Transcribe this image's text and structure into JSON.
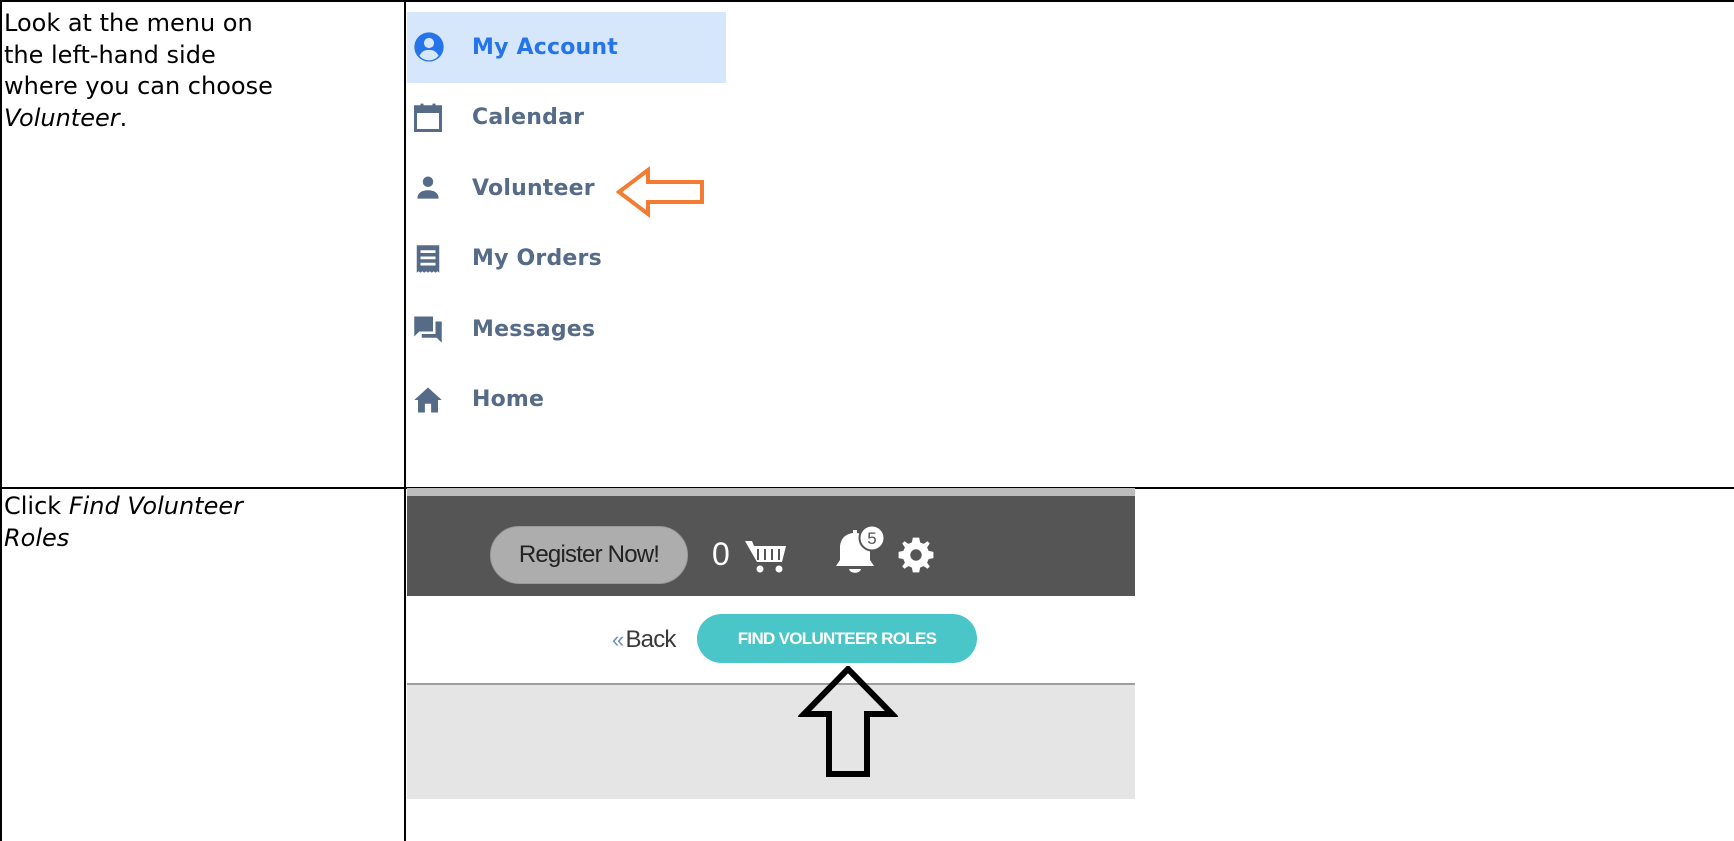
{
  "row1": {
    "instruction_lines": [
      "Look at the menu on",
      "the left-hand side",
      "where you can choose"
    ],
    "instruction_emph": "Volunteer",
    "instruction_tail": "."
  },
  "menu": {
    "items": [
      {
        "label": "My Account",
        "icon": "account-circle-icon",
        "active": true
      },
      {
        "label": "Calendar",
        "icon": "calendar-icon",
        "active": false
      },
      {
        "label": "Volunteer",
        "icon": "person-icon",
        "active": false
      },
      {
        "label": "My Orders",
        "icon": "receipt-icon",
        "active": false
      },
      {
        "label": "Messages",
        "icon": "chat-bubbles-icon",
        "active": false
      },
      {
        "label": "Home",
        "icon": "home-icon",
        "active": false
      }
    ],
    "active_color": "#2574ea",
    "active_bg": "#d6e6fb",
    "item_color": "#556b87"
  },
  "row2": {
    "instruction_prefix": "Click ",
    "instruction_emph_line1": "Find Volunteer",
    "instruction_emph_line2": "Roles"
  },
  "shot": {
    "register_label": "Register Now!",
    "cart_count": "0",
    "notification_count": "5",
    "back_chevron": "«",
    "back_label": "Back",
    "find_label": "FIND VOLUNTEER ROLES",
    "find_color": "#4bc6c8",
    "header_color": "#555555"
  },
  "annotations": {
    "orange_arrow_color": "#f47b30",
    "black_arrow_color": "#000000"
  }
}
